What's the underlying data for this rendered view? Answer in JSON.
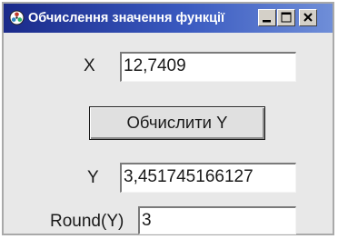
{
  "window": {
    "title": "Обчислення значення функції",
    "icon": "app-icon",
    "controls": {
      "minimize_icon": "minimize-icon",
      "maximize_icon": "maximize-icon",
      "close_icon": "close-icon"
    }
  },
  "form": {
    "x_label": "X",
    "x_value": "12,7409",
    "calculate_button": "Обчислити Y",
    "y_label": "Y",
    "y_value": "3,451745166127",
    "round_label": "Round(Y)",
    "round_value": "3"
  },
  "colors": {
    "title_bar_start": "#1a2a8a",
    "title_bar_end": "#6f8ed8",
    "window_background": "#e8e8e8",
    "field_background": "#ffffff"
  }
}
